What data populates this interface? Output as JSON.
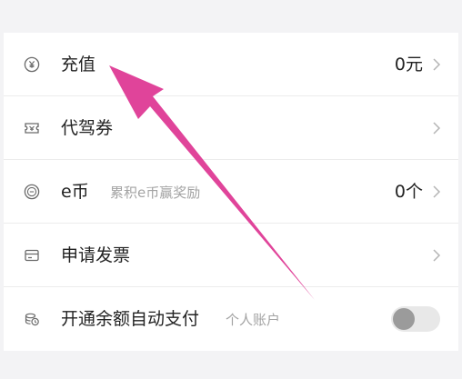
{
  "rows": [
    {
      "icon": "yuan-coin-icon",
      "label": "充值",
      "value": "0元"
    },
    {
      "icon": "coupon-ticket-icon",
      "label": "代驾券"
    },
    {
      "icon": "e-coin-icon",
      "label": "e币",
      "sub": "累积e币赢奖励",
      "value": "0个"
    },
    {
      "icon": "invoice-icon",
      "label": "申请发票"
    },
    {
      "icon": "auto-pay-icon",
      "label": "开通余额自动支付",
      "sub": "个人账户",
      "toggle_on": false
    }
  ],
  "colors": {
    "annotation_arrow": "#e0449a",
    "text": "#222222",
    "subtext": "#a3a3a3",
    "background": "#f3f3f5"
  }
}
